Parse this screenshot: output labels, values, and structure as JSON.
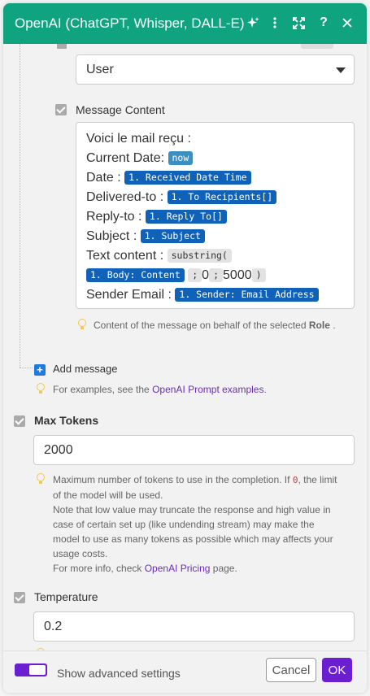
{
  "header": {
    "title": "OpenAI (ChatGPT, Whisper, DALL-E)",
    "icons": [
      "sparkle-icon",
      "more-vertical-icon",
      "expand-icon",
      "help-icon",
      "close-icon"
    ],
    "color": "#10a37f"
  },
  "role_select": {
    "value": "User"
  },
  "message_content": {
    "label": "Message Content",
    "lines": {
      "l1": "Voici le mail reçu :",
      "l2_text": "Current Date:",
      "l2_pill": "now",
      "l3_text": "Date :",
      "l3_pill": "1. Received Date Time",
      "l4_text": "Delivered-to :",
      "l4_pill": "1. To Recipients[]",
      "l5_text": "Reply-to :",
      "l5_pill": "1. Reply To[]",
      "l6_text": "Subject :",
      "l6_pill": "1. Subject",
      "l7_text": "Text content :",
      "l7_pill": "substring(",
      "l8_pill1": "1. Body: Content",
      "l8_sep1": ";",
      "l8_num1": "0",
      "l8_sep2": ";",
      "l8_num2": "5000",
      "l8_close": ")",
      "l9_text": "Sender Email :",
      "l9_pill": "1. Sender: Email Address"
    },
    "hint_prefix": "Content of the message on behalf of the selected",
    "hint_bold": "Role",
    "hint_suffix": "."
  },
  "add_message": {
    "label": "Add message",
    "hint_prefix": "For examples, see the",
    "hint_link": "OpenAI Prompt examples",
    "hint_suffix": "."
  },
  "max_tokens": {
    "label": "Max Tokens",
    "value": "2000",
    "hint_a": "Maximum number of tokens to use in the completion. If",
    "hint_code": "0",
    "hint_b": ", the limit",
    "hint_c": "of the model will be used.",
    "hint_d": "Note that low value may truncate the response and high value in",
    "hint_e": "case of certain set up (like undending stream) may make the",
    "hint_f": "model to use as many tokens as possible which may affects your",
    "hint_g": "usage costs.",
    "hint_h": "For more info, check",
    "hint_link": "OpenAI Pricing",
    "hint_i": "page."
  },
  "temperature": {
    "label": "Temperature",
    "value": "0.2"
  },
  "footer": {
    "advanced_label": "Show advanced settings",
    "cancel_label": "Cancel",
    "ok_label": "OK",
    "accent": "#6b1fd1"
  }
}
